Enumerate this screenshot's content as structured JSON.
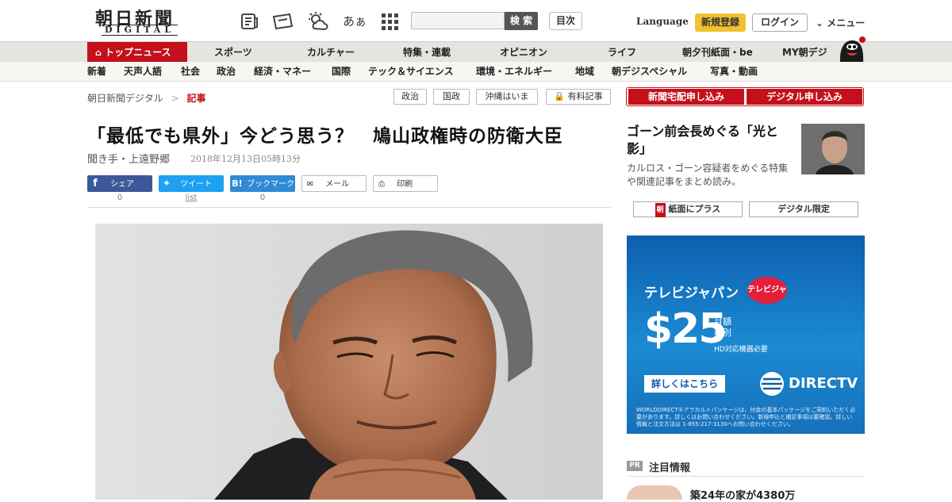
{
  "header": {
    "logo_main": "朝日新聞",
    "logo_sub": "DIGITAL",
    "font_size_label": "あぁ",
    "search_placeholder": "",
    "search_button": "検 索",
    "index_button": "目次",
    "language": "Language",
    "register": "新規登録",
    "login": "ログイン",
    "menu": "メニュー",
    "icons": [
      "newspaper-icon",
      "coupon-icon",
      "weather-icon",
      "font-size-icon",
      "grid-icon"
    ]
  },
  "nav_primary": [
    "トップニュース",
    "スポーツ",
    "カルチャー",
    "特集・連載",
    "オピニオン",
    "ライフ",
    "朝夕刊紙面・be",
    "MY朝デジ"
  ],
  "nav_secondary": [
    "新着",
    "天声人語",
    "社会",
    "政治",
    "経済・マネー",
    "国際",
    "テック＆サイエンス",
    "環境・エネルギー",
    "地域",
    "朝デジスペシャル",
    "写真・動画"
  ],
  "breadcrumb": {
    "home": "朝日新聞デジタル",
    "separator": ">",
    "current": "記事"
  },
  "tags": [
    "政治",
    "国政",
    "沖縄はいま",
    "有料記事"
  ],
  "article": {
    "title": "「最低でも県外」今どう思う？　鳩山政権時の防衛大臣",
    "author": "聞き手・上遠野郷",
    "date": "2018年12月13日05時13分"
  },
  "share": {
    "facebook": {
      "label": "シェア",
      "count": "0"
    },
    "twitter": {
      "label": "ツイート",
      "count": "list"
    },
    "hatena": {
      "label": "ブックマーク",
      "count": "0"
    },
    "mail": {
      "label": "メール"
    },
    "print": {
      "label": "印刷"
    }
  },
  "sidebar": {
    "subscribe_paper": "新聞宅配申し込み",
    "subscribe_digital": "デジタル申し込み",
    "feature_headline": "ゴーン前会長めぐる「光と影」",
    "feature_body": "カルロス・ゴーン容疑者をめぐる特集や関連記事をまとめ読み。",
    "tab_paper": "紙面にプラス",
    "tab_digital": "デジタル限定"
  },
  "ad": {
    "brand": "テレビジャパン",
    "logo_text": "テレビジャパン",
    "price": "$25",
    "price_unit_1": "月額",
    "price_unit_2": "税別",
    "note": "HD対応機器必要",
    "cta": "詳しくはこちら",
    "provider": "DIRECTV",
    "fine_print": "WORLDDIRECT®アラカルトパッケージは、付金の基本パッケージをご契約いただく必要があります。詳しくはお問い合わせください。新規申込と補足事項は要確認。詳しい情報と注文方法は 1-855-217-3130へお問い合わせください。"
  },
  "pr": {
    "badge": "PR",
    "title": "注目情報",
    "item": "築24年の家が4380万"
  },
  "colors": {
    "brand_red": "#c4101a",
    "accent_yellow": "#f2c12e",
    "facebook": "#3b5998",
    "twitter": "#1da1f2",
    "hatena": "#2f8ad4"
  }
}
